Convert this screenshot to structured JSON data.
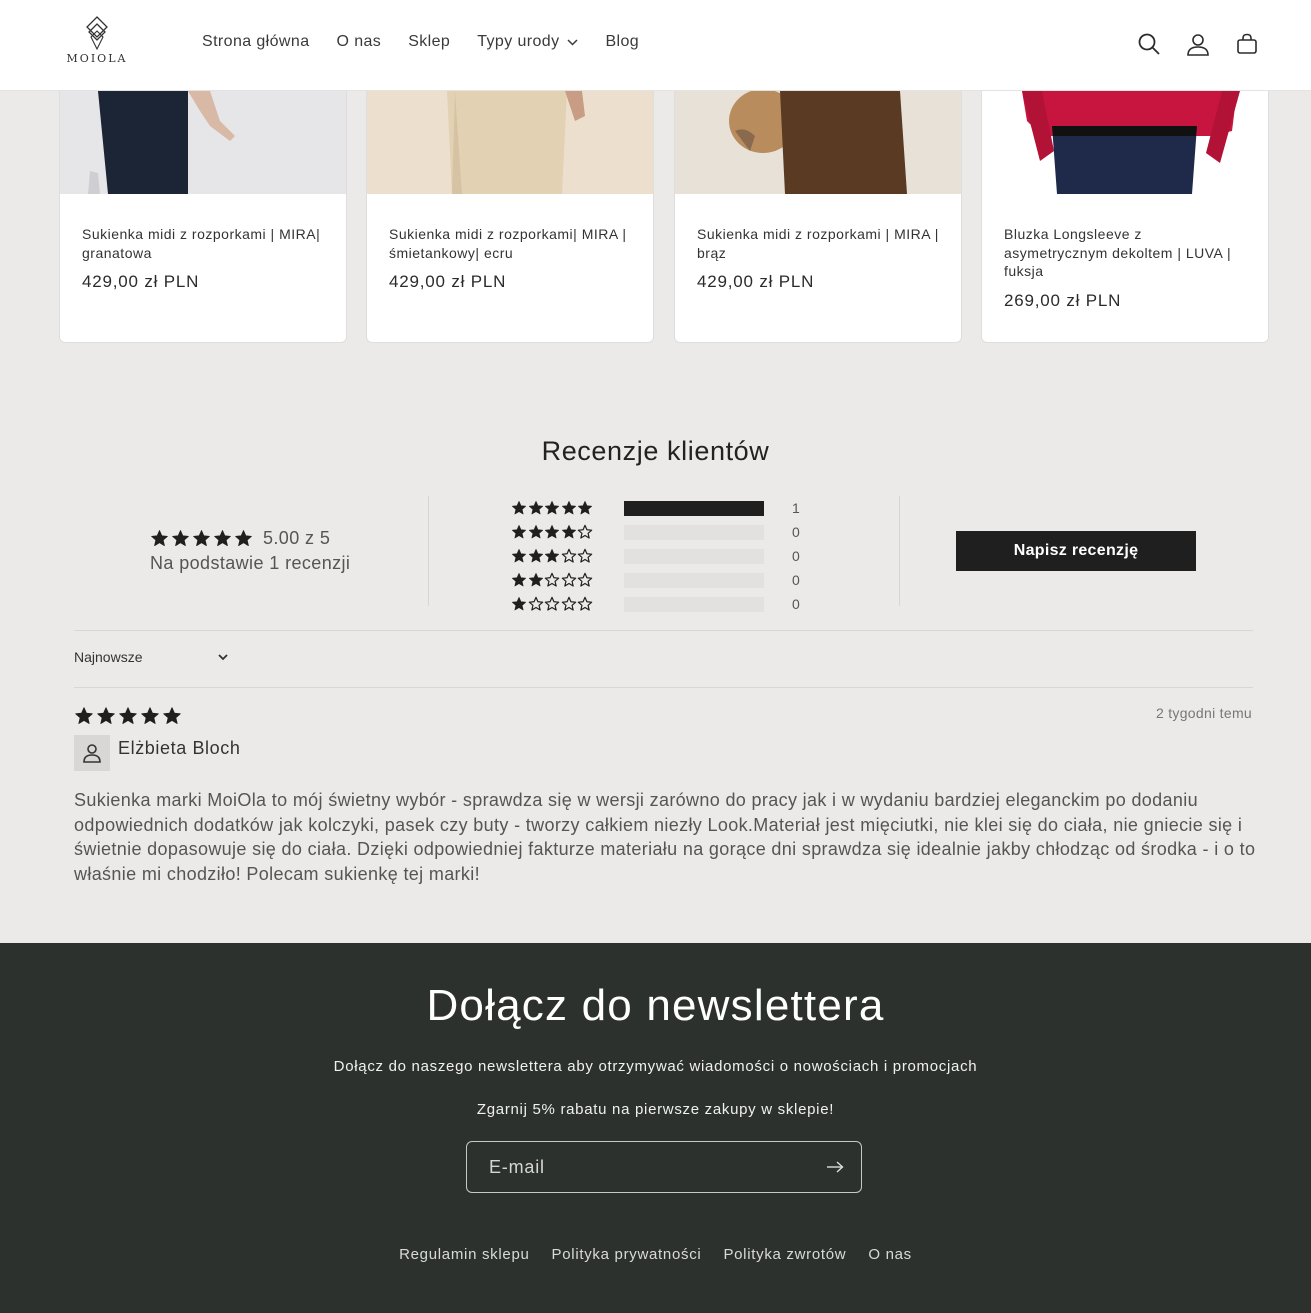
{
  "header": {
    "logo_text": "MOIOLA",
    "nav": [
      {
        "label": "Strona główna"
      },
      {
        "label": "O nas"
      },
      {
        "label": "Sklep"
      },
      {
        "label": "Typy urody",
        "dropdown": true
      },
      {
        "label": "Blog"
      }
    ],
    "icons": [
      "search-icon",
      "account-icon",
      "cart-icon"
    ]
  },
  "products": [
    {
      "title": "Sukienka midi z rozporkami | MIRA| granatowa",
      "price": "429,00 zł PLN",
      "image_colors": [
        "#e8e8ea",
        "#1c2536"
      ]
    },
    {
      "title": "Sukienka midi z rozporkami| MIRA | śmietankowy| ecru",
      "price": "429,00 zł PLN",
      "image_colors": [
        "#ecdcc8",
        "#e6d5b8"
      ]
    },
    {
      "title": "Sukienka midi z rozporkami | MIRA | brąz",
      "price": "429,00 zł PLN",
      "image_colors": [
        "#e9e3da",
        "#5a3a22"
      ]
    },
    {
      "title": "Bluzka Longsleeve z asymetrycznym dekoltem | LUVA | fuksja",
      "price": "269,00 zł PLN",
      "image_colors": [
        "#ffffff",
        "#1f2a4a"
      ]
    }
  ],
  "reviews": {
    "heading": "Recenzje klientów",
    "average_text": "5.00 z 5",
    "basis_text": "Na podstawie 1 recenzji",
    "average_rating": 5,
    "histogram": [
      {
        "stars": 5,
        "count": "1",
        "fraction": 1.0
      },
      {
        "stars": 4,
        "count": "0",
        "fraction": 0
      },
      {
        "stars": 3,
        "count": "0",
        "fraction": 0
      },
      {
        "stars": 2,
        "count": "0",
        "fraction": 0
      },
      {
        "stars": 1,
        "count": "0",
        "fraction": 0
      }
    ],
    "write_button": "Napisz recenzję",
    "sort_label": "Najnowsze",
    "items": [
      {
        "rating": 5,
        "date": "2 tygodni temu",
        "author": "Elżbieta Bloch",
        "text": "Sukienka marki MoiOla to mój świetny wybór - sprawdza się w wersji zarówno do pracy jak i w wydaniu bardziej eleganckim po dodaniu odpowiednich dodatków jak kolczyki, pasek czy buty - tworzy całkiem niezły Look.Materiał jest mięciutki, nie klei się do ciała, nie gniecie się i świetnie dopasowuje się do ciała. Dzięki odpowiedniej fakturze materiału na gorące dni sprawdza się idealnie jakby chłodząc od środka - i o to właśnie mi chodziło! Polecam sukienkę tej marki!"
      }
    ]
  },
  "newsletter": {
    "title": "Dołącz do newslettera",
    "text1": "Dołącz do naszego newslettera aby otrzymywać wiadomości o nowościach i promocjach",
    "text2": "Zgarnij 5% rabatu na pierwsze zakupy w sklepie!",
    "email_placeholder": "E-mail"
  },
  "footer": {
    "links": [
      "Regulamin sklepu",
      "Polityka prywatności",
      "Polityka zwrotów",
      "O nas"
    ]
  },
  "colors": {
    "accent": "#1f1f1f",
    "background": "#eceae8",
    "newsletter_bg": "#2d312e"
  }
}
